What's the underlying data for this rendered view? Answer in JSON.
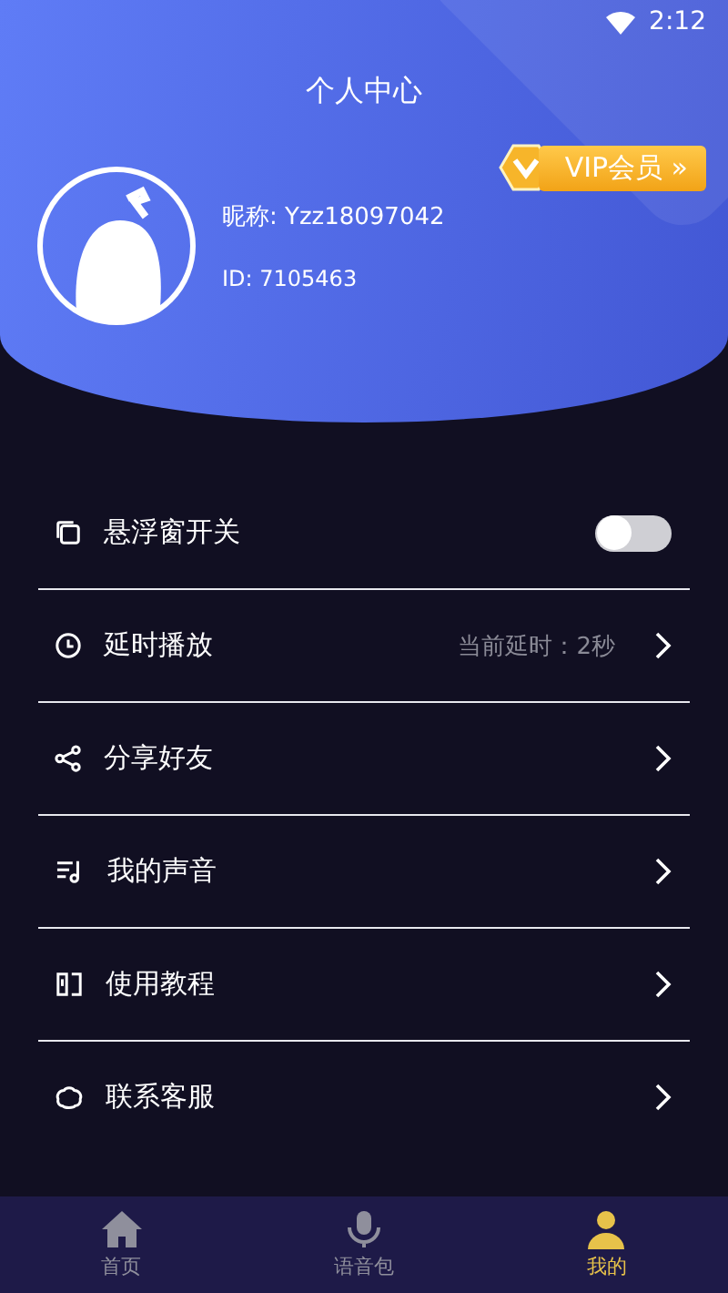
{
  "status_bar": {
    "time": "2:12"
  },
  "header": {
    "title": "个人中心",
    "nickname": "昵称: Yzz18097042",
    "id": "ID: 7105463",
    "vip_badge": "VIP会员 »"
  },
  "settings": [
    {
      "kind": "toggle",
      "label": "悬浮窗开关",
      "on": false
    },
    {
      "kind": "link",
      "label": "延时播放",
      "value": "当前延时：2秒"
    },
    {
      "kind": "link",
      "label": "分享好友"
    },
    {
      "kind": "link",
      "label": "我的声音"
    },
    {
      "kind": "link",
      "label": "使用教程"
    },
    {
      "kind": "link",
      "label": "联系客服"
    }
  ],
  "tab_bar": [
    {
      "label": "首页",
      "selected": false
    },
    {
      "label": "语音包",
      "selected": false
    },
    {
      "label": "我的",
      "selected": true
    }
  ]
}
